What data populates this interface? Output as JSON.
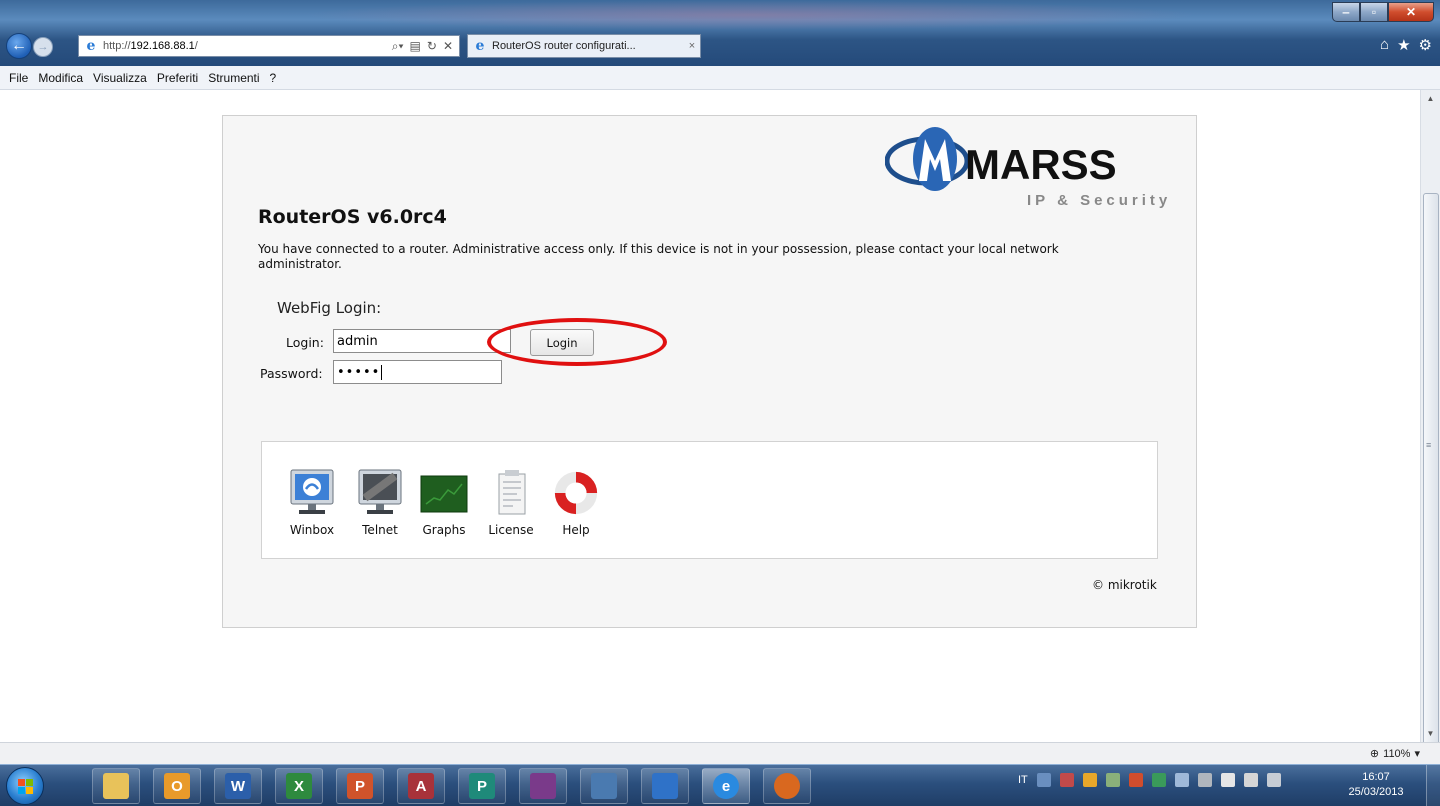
{
  "browser": {
    "address_prefix": "http://",
    "address_host": "192.168.88.1",
    "address_suffix": "/",
    "tab_title": "RouterOS router configurati...",
    "tab_close": "×",
    "menu": [
      "File",
      "Modifica",
      "Visualizza",
      "Preferiti",
      "Strumenti",
      "?"
    ],
    "zoom": "110%"
  },
  "page": {
    "logo_text": "MARSS",
    "logo_subtext": "IP & Security",
    "title": "RouterOS v6.0rc4",
    "notice": "You have connected to a router. Administrative access only. If this device is not in your possession, please contact your local network administrator.",
    "webfig_label": "WebFig Login:",
    "login_label": "Login:",
    "login_value": "admin",
    "password_label": "Password:",
    "password_value": "•••••",
    "login_button": "Login",
    "tools": [
      {
        "label": "Winbox",
        "icon": "winbox-icon"
      },
      {
        "label": "Telnet",
        "icon": "telnet-icon"
      },
      {
        "label": "Graphs",
        "icon": "graphs-icon"
      },
      {
        "label": "License",
        "icon": "license-icon"
      },
      {
        "label": "Help",
        "icon": "help-icon"
      }
    ],
    "copyright": "© mikrotik"
  },
  "taskbar": {
    "language": "IT",
    "time": "16:07",
    "date": "25/03/2013",
    "apps": [
      {
        "name": "file-explorer",
        "glyph": "",
        "color": "#e8c25a"
      },
      {
        "name": "outlook",
        "glyph": "O",
        "color": "#e89a2a"
      },
      {
        "name": "word",
        "glyph": "W",
        "color": "#2b5faa"
      },
      {
        "name": "excel",
        "glyph": "X",
        "color": "#2e8a3e"
      },
      {
        "name": "powerpoint",
        "glyph": "P",
        "color": "#d0532b"
      },
      {
        "name": "access",
        "glyph": "A",
        "color": "#a8323a"
      },
      {
        "name": "publisher",
        "glyph": "P",
        "color": "#1f8a7a"
      },
      {
        "name": "winrar",
        "glyph": "",
        "color": "#7a3a8a"
      },
      {
        "name": "notepad",
        "glyph": "",
        "color": "#4a7ab0"
      },
      {
        "name": "media-player",
        "glyph": "",
        "color": "#2f72c8"
      },
      {
        "name": "internet-explorer",
        "glyph": "e",
        "color": "#2a8ae0"
      },
      {
        "name": "firefox",
        "glyph": "",
        "color": "#d9681f"
      }
    ]
  },
  "colors": {
    "accent_red": "#e01010",
    "page_bg": "#f6f6f6",
    "titlebar": "#2d5585"
  }
}
